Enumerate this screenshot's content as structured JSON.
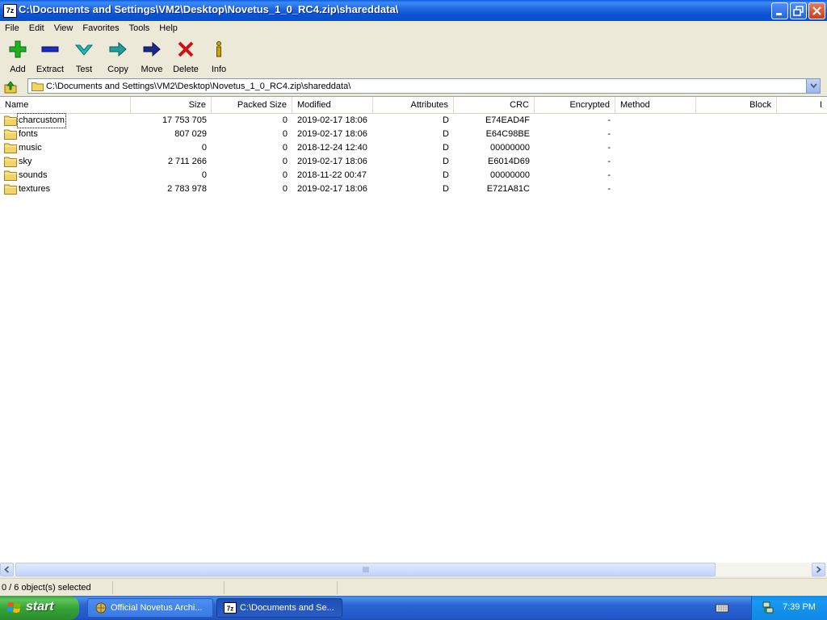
{
  "window": {
    "app_icon": "7z",
    "title": "C:\\Documents and Settings\\VM2\\Desktop\\Novetus_1_0_RC4.zip\\shareddata\\",
    "icons": [
      "minimize-icon",
      "maximize-icon",
      "close-icon"
    ]
  },
  "menu": [
    "File",
    "Edit",
    "View",
    "Favorites",
    "Tools",
    "Help"
  ],
  "toolbar": [
    {
      "label": "Add",
      "icon": "add-icon",
      "color": "#22b022"
    },
    {
      "label": "Extract",
      "icon": "extract-icon",
      "color": "#1a2dbf"
    },
    {
      "label": "Test",
      "icon": "test-icon",
      "color": "#1fb8b8"
    },
    {
      "label": "Copy",
      "icon": "copy-icon",
      "color": "#1f9e9e"
    },
    {
      "label": "Move",
      "icon": "move-icon",
      "color": "#1a2a8a"
    },
    {
      "label": "Delete",
      "icon": "delete-icon",
      "color": "#d01010"
    },
    {
      "label": "Info",
      "icon": "info-icon",
      "color": "#c8a800"
    }
  ],
  "address": {
    "path": "C:\\Documents and Settings\\VM2\\Desktop\\Novetus_1_0_RC4.zip\\shareddata\\"
  },
  "columns": [
    "Name",
    "Size",
    "Packed Size",
    "Modified",
    "Attributes",
    "CRC",
    "Encrypted",
    "Method",
    "Block",
    "I"
  ],
  "files": [
    {
      "name": "charcustom",
      "size": "17 753 705",
      "packed": "0",
      "modified": "2019-02-17 18:06",
      "attr": "D",
      "crc": "E74EAD4F",
      "enc": "-"
    },
    {
      "name": "fonts",
      "size": "807 029",
      "packed": "0",
      "modified": "2019-02-17 18:06",
      "attr": "D",
      "crc": "E64C98BE",
      "enc": "-"
    },
    {
      "name": "music",
      "size": "0",
      "packed": "0",
      "modified": "2018-12-24 12:40",
      "attr": "D",
      "crc": "00000000",
      "enc": "-"
    },
    {
      "name": "sky",
      "size": "2 711 266",
      "packed": "0",
      "modified": "2019-02-17 18:06",
      "attr": "D",
      "crc": "E6014D69",
      "enc": "-"
    },
    {
      "name": "sounds",
      "size": "0",
      "packed": "0",
      "modified": "2018-11-22 00:47",
      "attr": "D",
      "crc": "00000000",
      "enc": "-"
    },
    {
      "name": "textures",
      "size": "2 783 978",
      "packed": "0",
      "modified": "2019-02-17 18:06",
      "attr": "D",
      "crc": "E721A81C",
      "enc": "-"
    }
  ],
  "status": {
    "selection": "0 / 6 object(s) selected"
  },
  "taskbar": {
    "start_label": "start",
    "tasks": [
      {
        "label": "Official Novetus Archi...",
        "active": false
      },
      {
        "label": "C:\\Documents and Se...",
        "active": true
      }
    ],
    "clock": "7:39 PM"
  }
}
